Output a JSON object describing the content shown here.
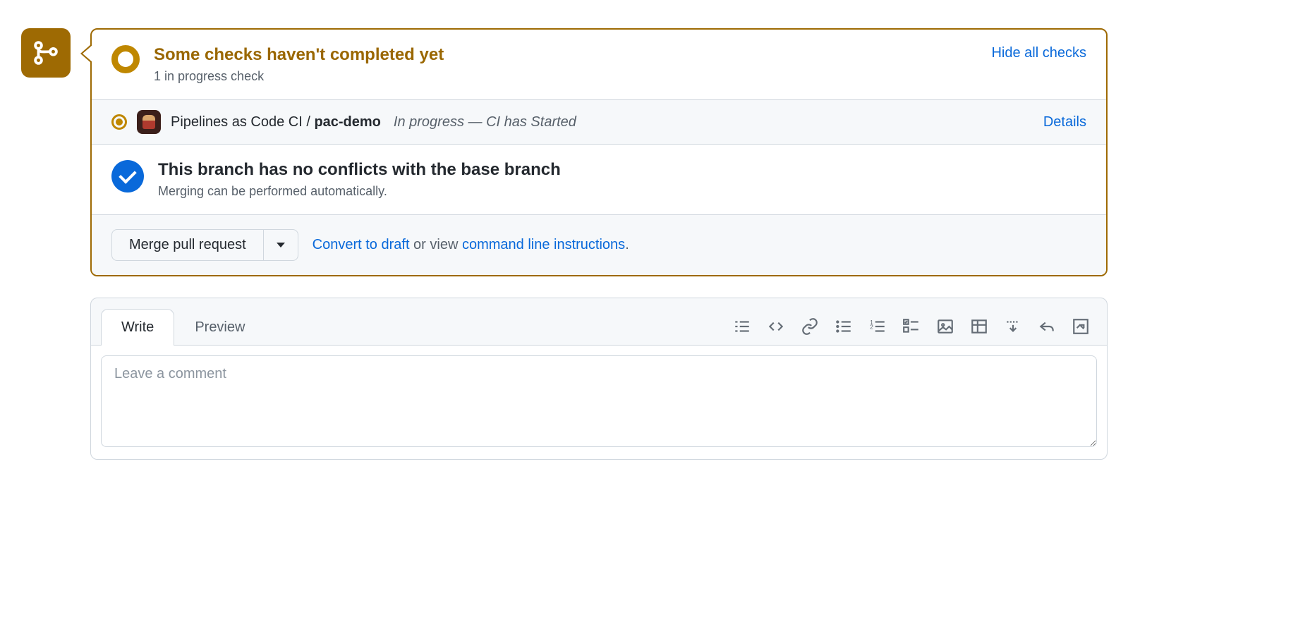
{
  "checksSection": {
    "title": "Some checks haven't completed yet",
    "subtitle": "1 in progress check",
    "hideLink": "Hide all checks"
  },
  "checkRow": {
    "appNamePrefix": "Pipelines as Code CI / ",
    "appNameBold": "pac-demo",
    "status": "In progress — CI has Started",
    "detailsLink": "Details"
  },
  "conflictSection": {
    "title": "This branch has no conflicts with the base branch",
    "subtitle": "Merging can be performed automatically."
  },
  "mergeFooter": {
    "mergeButton": "Merge pull request",
    "convertLink": "Convert to draft",
    "orViewText": " or view ",
    "cmdLink": "command line instructions",
    "period": "."
  },
  "comment": {
    "writeTab": "Write",
    "previewTab": "Preview",
    "placeholder": "Leave a comment"
  }
}
